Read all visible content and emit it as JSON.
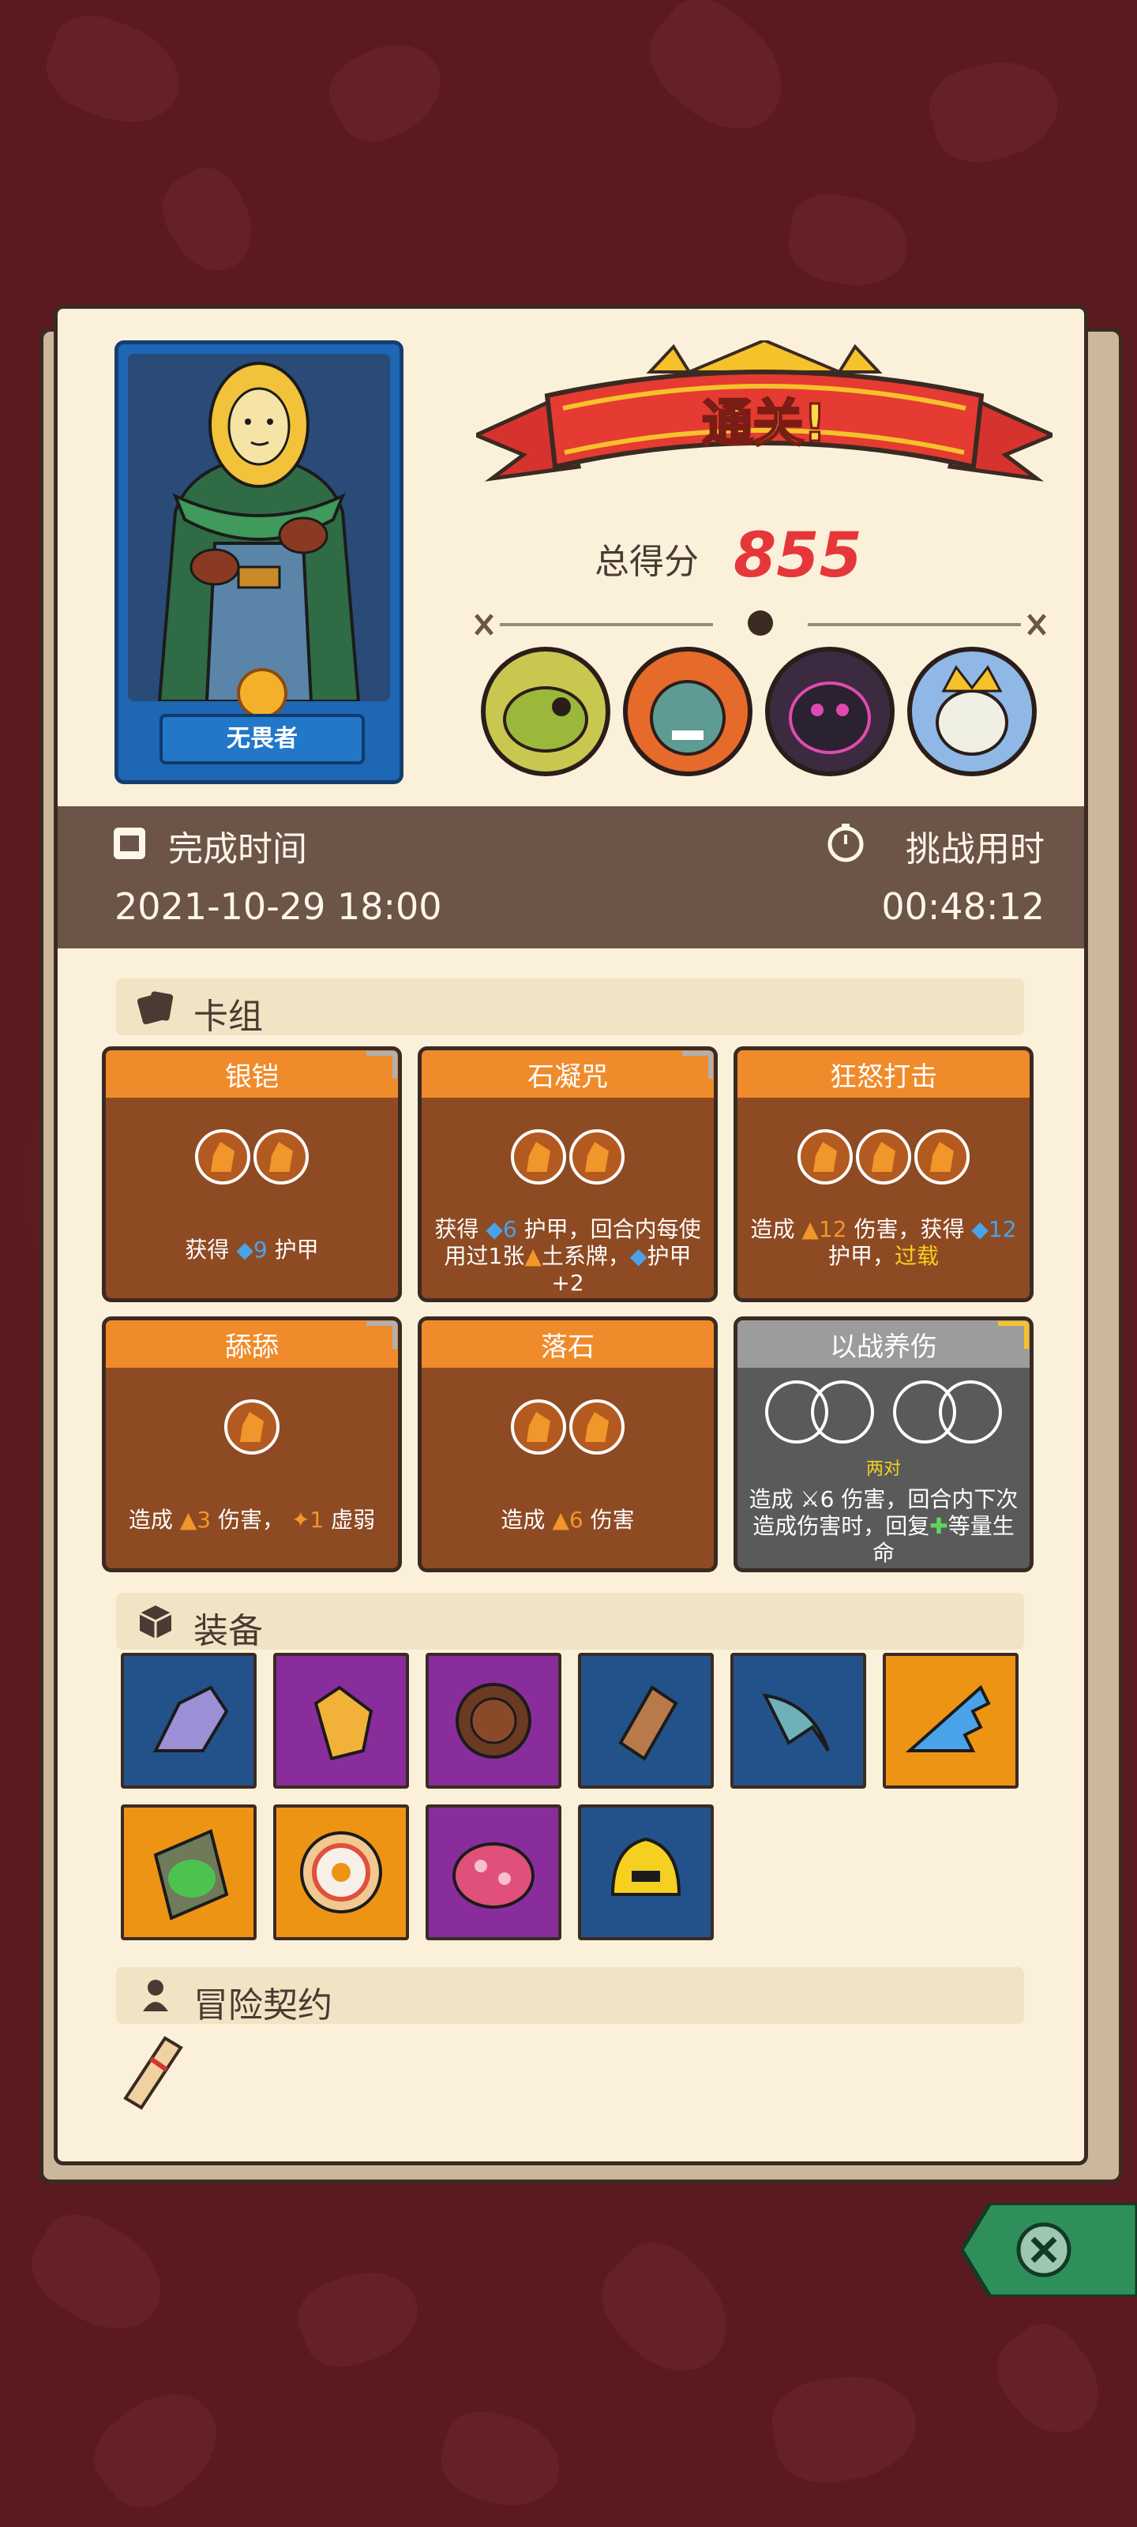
{
  "result": {
    "banner_text": "通关!",
    "score_label": "总得分",
    "score_value": "855",
    "hero_name": "无畏者"
  },
  "times": {
    "finish_label": "完成时间",
    "finish_value": "2021-10-29 18:00",
    "duration_label": "挑战用时",
    "duration_value": "00:48:12"
  },
  "deck": {
    "title": "卡组",
    "cards": [
      {
        "title": "银铠",
        "style": "orange",
        "desc": [
          "获得 ",
          {
            "icon": "shield"
          },
          "9 护甲"
        ]
      },
      {
        "title": "石凝咒",
        "style": "orange"
      },
      {
        "title": "狂怒打击",
        "style": "orange"
      },
      {
        "title": "舔舔",
        "style": "orange"
      },
      {
        "title": "落石",
        "style": "orange"
      },
      {
        "title": "以战养伤",
        "style": "gray",
        "note": "两对"
      }
    ],
    "texts": {
      "c1": "获得",
      "c1_num": "9",
      "c1_tail": "护甲",
      "c2_a": "获得",
      "c2_num": "6",
      "c2_b": "护甲，回合内每使用过1张",
      "c2_c": "土系牌，",
      "c2_d": "护甲+2",
      "c3_a": "造成",
      "c3_num": "12",
      "c3_b": "伤害，获得",
      "c3_num2": "12",
      "c3_c": "护甲，",
      "c3_overload": "过载",
      "c4_a": "造成",
      "c4_num": "3",
      "c4_b": "伤害，",
      "c4_num2": "1",
      "c4_c": "虚弱",
      "c5_a": "造成",
      "c5_num": "6",
      "c5_b": "伤害",
      "c6_a": "造成",
      "c6_num": "6",
      "c6_b": "伤害，回合内下次造成伤害时，回复",
      "c6_c": "等量生命"
    }
  },
  "equipment": {
    "title": "装备",
    "items": [
      {
        "name": "claw-gauntlet-icon",
        "rarity": "blue"
      },
      {
        "name": "glove-icon",
        "rarity": "purple"
      },
      {
        "name": "buttons-icon",
        "rarity": "purple"
      },
      {
        "name": "bracer-icon",
        "rarity": "blue"
      },
      {
        "name": "blade-icon",
        "rarity": "blue"
      },
      {
        "name": "spiked-blade-icon",
        "rarity": "orange"
      },
      {
        "name": "moss-slab-icon",
        "rarity": "orange"
      },
      {
        "name": "donut-icon",
        "rarity": "orange"
      },
      {
        "name": "mushroom-cap-icon",
        "rarity": "purple"
      },
      {
        "name": "gold-helmet-icon",
        "rarity": "blue"
      }
    ]
  },
  "contract": {
    "title": "冒险契约"
  },
  "colors": {
    "background": "#5a1a20",
    "panel": "#fbf1da",
    "score": "#e5373a",
    "card_orange": "#f08b2b",
    "card_body": "#8e4a22",
    "armor_blue": "#4aa3e8",
    "damage_orange": "#f0962a",
    "close_green": "#2e8f5a"
  }
}
